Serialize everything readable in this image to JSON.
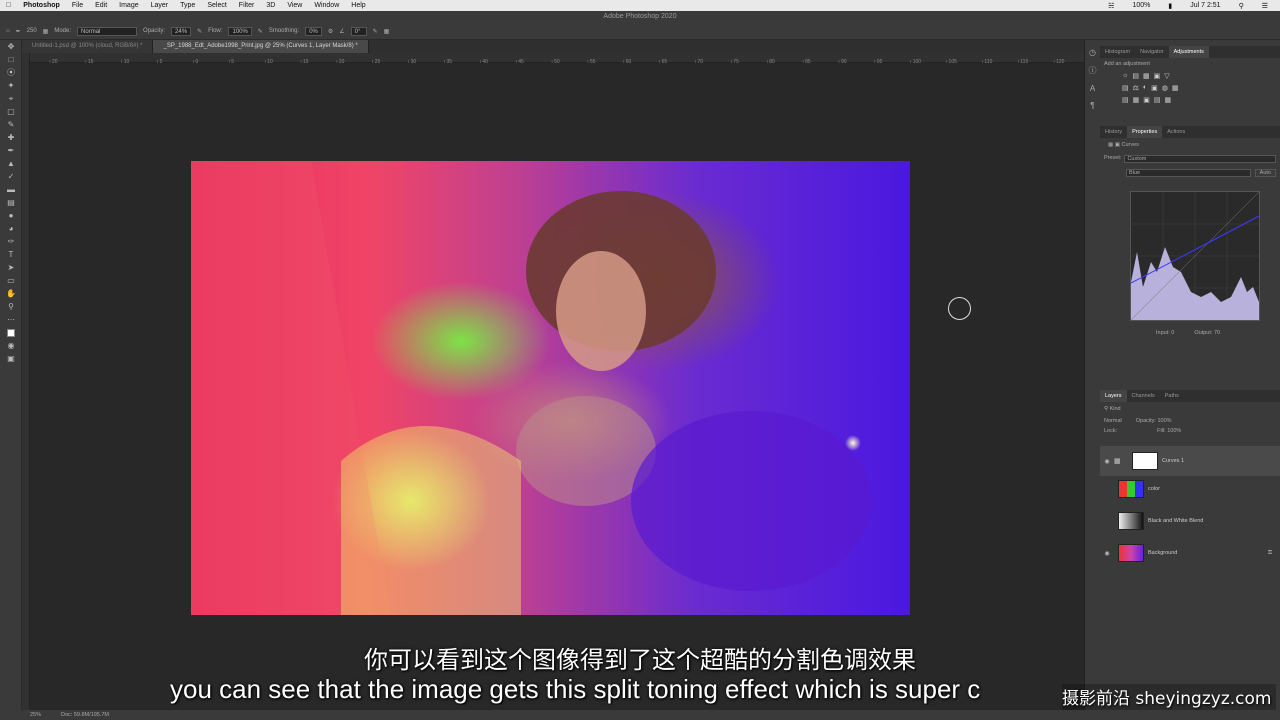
{
  "menubar": {
    "apple": "",
    "items": [
      "Photoshop",
      "File",
      "Edit",
      "Image",
      "Layer",
      "Type",
      "Select",
      "Filter",
      "3D",
      "View",
      "Window",
      "Help"
    ],
    "battery": "100%",
    "date": "Jul 7  2:51"
  },
  "window_title": "Adobe Photoshop 2020",
  "options": {
    "brush_size": "250",
    "mode_label": "Mode:",
    "mode_value": "Normal",
    "opacity_label": "Opacity:",
    "opacity_value": "24%",
    "flow_label": "Flow:",
    "flow_value": "100%",
    "smoothing_label": "Smoothing:",
    "smoothing_value": "0%",
    "angle_value": "0°"
  },
  "tabs": [
    {
      "label": "Untitled-1.psd @ 100% (cloud, RGB/8#) *",
      "active": false
    },
    {
      "label": "_SP_1988_Edt_Adobe1998_Print.jpg @ 25% (Curves 1, Layer Mask/8) *",
      "active": true
    }
  ],
  "ruler_h_ticks": [
    "20",
    "15",
    "10",
    "5",
    "0",
    "5",
    "10",
    "15",
    "20",
    "25",
    "30",
    "35",
    "40",
    "45",
    "50",
    "55",
    "60",
    "65",
    "70",
    "75",
    "80",
    "85",
    "90",
    "95",
    "100",
    "105",
    "110",
    "115",
    "120"
  ],
  "right_panel": {
    "top_tabs": [
      "Histogram",
      "Navigator",
      "Adjustments"
    ],
    "add_adjustment": "Add an adjustment",
    "mid_tabs": [
      "History",
      "Properties",
      "Actions"
    ],
    "curves_label": "Curves",
    "preset_label": "Preset:",
    "preset_value": "Custom",
    "channel_value": "Blue",
    "auto_label": "Auto",
    "input_label": "Input:",
    "input_value": "0",
    "output_label": "Output:",
    "output_value": "70",
    "layer_tabs": [
      "Layers",
      "Channels",
      "Paths"
    ],
    "kind_label": "Kind",
    "blend_mode": "Normal",
    "opacity_label": "Opacity:",
    "opacity_value": "100%",
    "lock_label": "Lock:",
    "fill_label": "Fill:",
    "fill_value": "100%",
    "layers": [
      {
        "name": "Curves 1",
        "selected": true,
        "visible": true
      },
      {
        "name": "color",
        "selected": false,
        "visible": false
      },
      {
        "name": "Black and White Blend",
        "selected": false,
        "visible": false
      },
      {
        "name": "Background",
        "selected": false,
        "visible": true
      }
    ]
  },
  "status": {
    "zoom": "25%",
    "doc": "Doc: 59.8M/195.7M"
  },
  "subtitle_cn": "你可以看到这个图像得到了这个超酷的分割色调效果",
  "subtitle_en": "you can see that the image gets this split toning effect which is super c",
  "watermark": "摄影前沿 sheyingzyz.com"
}
